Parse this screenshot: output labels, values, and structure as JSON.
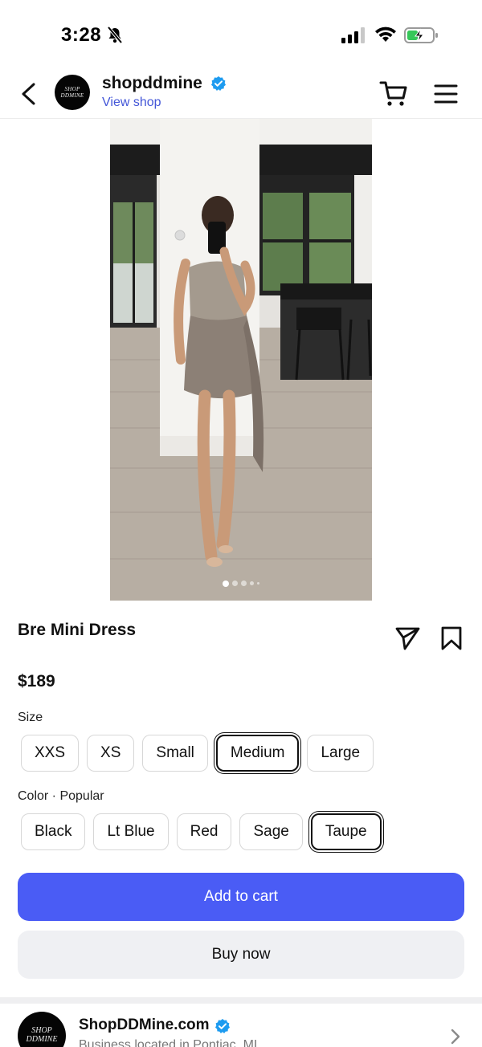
{
  "status_bar": {
    "time": "3:28",
    "icons": [
      "bell-slash-icon",
      "cellular-signal-icon",
      "wifi-icon",
      "battery-charging-icon"
    ]
  },
  "header": {
    "shop_name": "shopddmine",
    "view_shop_label": "View shop",
    "avatar_text": "SHOP DDMINE",
    "icons": [
      "back-chevron-icon",
      "verified-badge-icon",
      "cart-icon",
      "menu-icon"
    ]
  },
  "gallery": {
    "image_count": 5,
    "active_index": 0
  },
  "product": {
    "title": "Bre Mini Dress",
    "price": "$189",
    "size_label": "Size",
    "sizes": [
      "XXS",
      "XS",
      "Small",
      "Medium",
      "Large"
    ],
    "selected_size": "Medium",
    "color_label": "Color · Popular",
    "colors": [
      "Black",
      "Lt Blue",
      "Red",
      "Sage",
      "Taupe"
    ],
    "selected_color": "Taupe"
  },
  "actions": {
    "add_to_cart": "Add to cart",
    "buy_now": "Buy now"
  },
  "business": {
    "name": "ShopDDMine.com",
    "subtitle": "Business located in Pontiac, MI",
    "avatar_text": "SHOP DDMINE"
  },
  "colors": {
    "primary_button": "#4a5cf5",
    "link": "#4356d8",
    "verified": "#1d9bf0",
    "secondary_button": "#eff0f3"
  }
}
